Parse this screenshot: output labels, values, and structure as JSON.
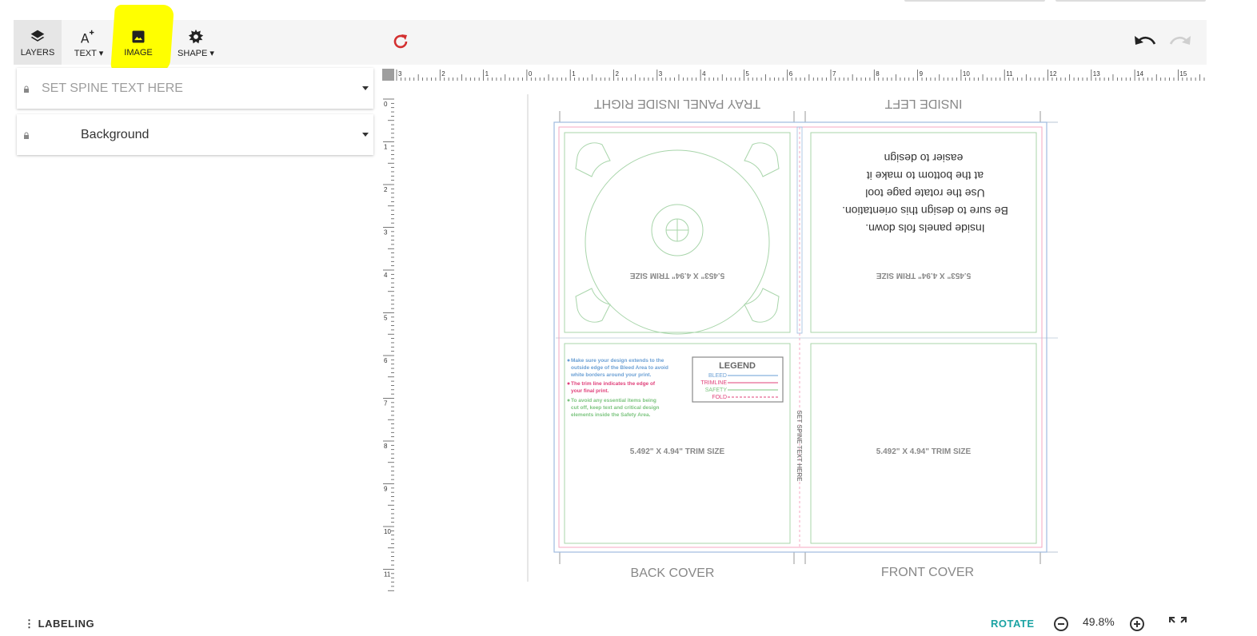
{
  "toolbar": {
    "tools": [
      {
        "label": "LAYERS",
        "icon": "layers-icon"
      },
      {
        "label": "TEXT",
        "icon": "text-add-icon",
        "dropdown": true
      },
      {
        "label": "IMAGE",
        "icon": "image-icon"
      },
      {
        "label": "SHAPE",
        "icon": "gear-icon",
        "dropdown": true
      }
    ],
    "refresh_icon": "refresh-icon",
    "undo_icon": "undo-icon",
    "redo_icon": "redo-icon"
  },
  "layers": [
    {
      "placeholder": "SET SPINE TEXT HERE",
      "icon": "lock-icon"
    },
    {
      "label": "Background",
      "icon": "lock-icon"
    }
  ],
  "ruler": {
    "horizontal": [
      "3",
      "2",
      "1",
      "0",
      "1",
      "2",
      "3",
      "4",
      "5",
      "6",
      "7",
      "8",
      "9",
      "10",
      "11",
      "12",
      "13",
      "14",
      "15"
    ],
    "vertical": [
      "0",
      "1",
      "2",
      "3",
      "4",
      "5",
      "6",
      "7",
      "8",
      "9",
      "10",
      "11"
    ]
  },
  "template": {
    "tray_label": "TRAY PANEL INSIDE RIGHT",
    "inside_left_label": "INSIDE LEFT",
    "back_label": "BACK COVER",
    "front_label": "FRONT COVER",
    "trim_tray": "5.453\" X 4.94\" TRIM SIZE",
    "trim_inside": "5.453\" X 4.94\" TRIM SIZE",
    "trim_back": "5.492\" X 4.94\" TRIM SIZE",
    "trim_front": "5.492\" X 4.94\" TRIM SIZE",
    "instructions": [
      "Inside panels fols down.",
      "Be sure to design this orientation.",
      "Use the rotate page tool",
      "at the bottom to make it",
      "easier to design"
    ],
    "spine_text": "SET SPINE TEXT HERE",
    "notes": {
      "bleed": [
        "Make sure your design extends to the",
        "outside edge of the Bleed Area to avoid",
        "white borders around your print."
      ],
      "trim": [
        "The trim line indicates the edge of",
        "your final print."
      ],
      "safety": [
        "To avoid any essential items being",
        "cut off, keep text and critical design",
        "elements inside the Safety Area."
      ]
    },
    "legend": {
      "title": "LEGEND",
      "items": [
        {
          "label": "BLEED",
          "color": "#6a9fd4"
        },
        {
          "label": "TRIMLINE",
          "color": "#e0407a"
        },
        {
          "label": "SAFETY",
          "color": "#7cc47f"
        },
        {
          "label": "FOLD",
          "color": "#e0407a"
        }
      ]
    }
  },
  "status": {
    "left": "LABELING",
    "rotate": "ROTATE",
    "zoom": "49.8%"
  },
  "colors": {
    "highlight": "#ffff00",
    "refresh": "#d32f2f",
    "rotate": "#1aa3a3",
    "bleed": "#6a9fd4",
    "trim": "#e0407a",
    "safety": "#7cc47f"
  }
}
